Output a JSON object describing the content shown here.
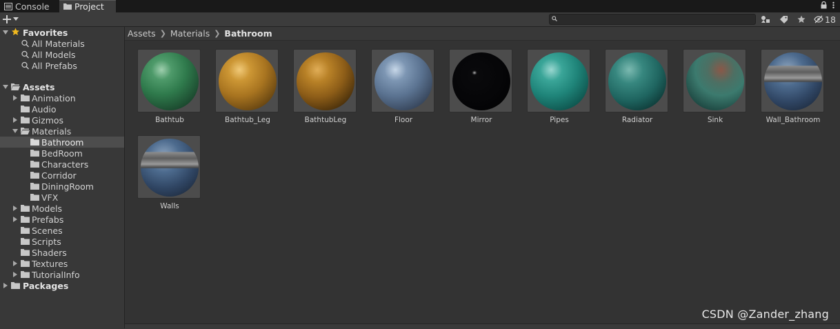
{
  "tabs": [
    {
      "label": "Console",
      "icon": "console-icon"
    },
    {
      "label": "Project",
      "icon": "folder-icon",
      "active": true
    }
  ],
  "toolbar": {
    "add_icon": "plus-icon",
    "search_placeholder": "",
    "hidden_count": "18"
  },
  "sidebar": {
    "favorites": {
      "label": "Favorites",
      "items": [
        "All Materials",
        "All Models",
        "All Prefabs"
      ]
    },
    "assets": {
      "label": "Assets"
    },
    "asset_folders": [
      "Animation",
      "Audio",
      "Gizmos",
      "Materials"
    ],
    "material_folders": [
      "Bathroom",
      "BedRoom",
      "Characters",
      "Corridor",
      "DiningRoom",
      "VFX"
    ],
    "asset_folders_after": [
      "Models",
      "Prefabs",
      "Scenes",
      "Scripts",
      "Shaders",
      "Textures",
      "TutorialInfo"
    ],
    "packages": {
      "label": "Packages"
    },
    "selected": "Bathroom"
  },
  "breadcrumb": {
    "items": [
      "Assets",
      "Materials",
      "Bathroom"
    ]
  },
  "materials": [
    "Bathtub",
    "Bathtub_Leg",
    "BathtubLeg",
    "Floor",
    "Mirror",
    "Pipes",
    "Radiator",
    "Sink",
    "Wall_Bathroom",
    "Walls"
  ],
  "watermark": "CSDN @Zander_zhang",
  "colors": {
    "background": "#383838",
    "grid": "#333333",
    "selection": "#4d4d4d",
    "favorite_star": "#f0b81f"
  }
}
